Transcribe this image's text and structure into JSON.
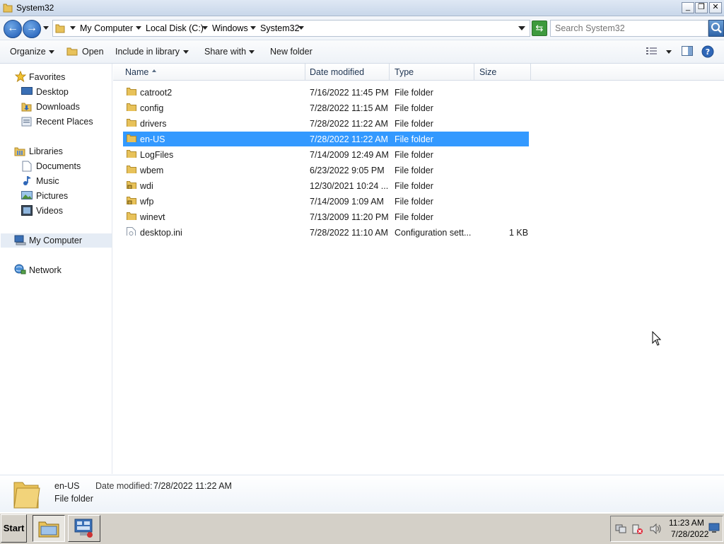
{
  "window": {
    "title": "System32"
  },
  "address": {
    "crumbs": [
      "My Computer",
      "Local Disk (C:)",
      "Windows",
      "System32"
    ]
  },
  "search": {
    "placeholder": "Search System32"
  },
  "toolbar": {
    "organize": "Organize",
    "open": "Open",
    "include_in_library": "Include in library",
    "share_with": "Share with",
    "new_folder": "New folder"
  },
  "nav": {
    "favorites": "Favorites",
    "desktop": "Desktop",
    "downloads": "Downloads",
    "recent_places": "Recent Places",
    "libraries": "Libraries",
    "documents": "Documents",
    "music": "Music",
    "pictures": "Pictures",
    "videos": "Videos",
    "my_computer": "My Computer",
    "network": "Network"
  },
  "columns": {
    "name": "Name",
    "date": "Date modified",
    "type": "Type",
    "size": "Size"
  },
  "files": [
    {
      "name": "catroot2",
      "date": "7/16/2022 11:45 PM",
      "type": "File folder",
      "size": ""
    },
    {
      "name": "config",
      "date": "7/28/2022 11:15 AM",
      "type": "File folder",
      "size": ""
    },
    {
      "name": "drivers",
      "date": "7/28/2022 11:22 AM",
      "type": "File folder",
      "size": ""
    },
    {
      "name": "en-US",
      "date": "7/28/2022 11:22 AM",
      "type": "File folder",
      "size": ""
    },
    {
      "name": "LogFiles",
      "date": "7/14/2009 12:49 AM",
      "type": "File folder",
      "size": ""
    },
    {
      "name": "wbem",
      "date": "6/23/2022 9:05 PM",
      "type": "File folder",
      "size": ""
    },
    {
      "name": "wdi",
      "date": "12/30/2021 10:24 ...",
      "type": "File folder",
      "size": ""
    },
    {
      "name": "wfp",
      "date": "7/14/2009 1:09 AM",
      "type": "File folder",
      "size": ""
    },
    {
      "name": "winevt",
      "date": "7/13/2009 11:20 PM",
      "type": "File folder",
      "size": ""
    },
    {
      "name": "desktop.ini",
      "date": "7/28/2022 11:10 AM",
      "type": "Configuration sett...",
      "size": "1 KB"
    }
  ],
  "details": {
    "name": "en-US",
    "date_label": "Date modified:",
    "date_value": "7/28/2022 11:22 AM",
    "type": "File folder"
  },
  "taskbar": {
    "start": "Start",
    "time": "11:23 AM",
    "date": "7/28/2022"
  },
  "colors": {
    "selection": "#3399ff",
    "folder": "#e8c25a"
  }
}
